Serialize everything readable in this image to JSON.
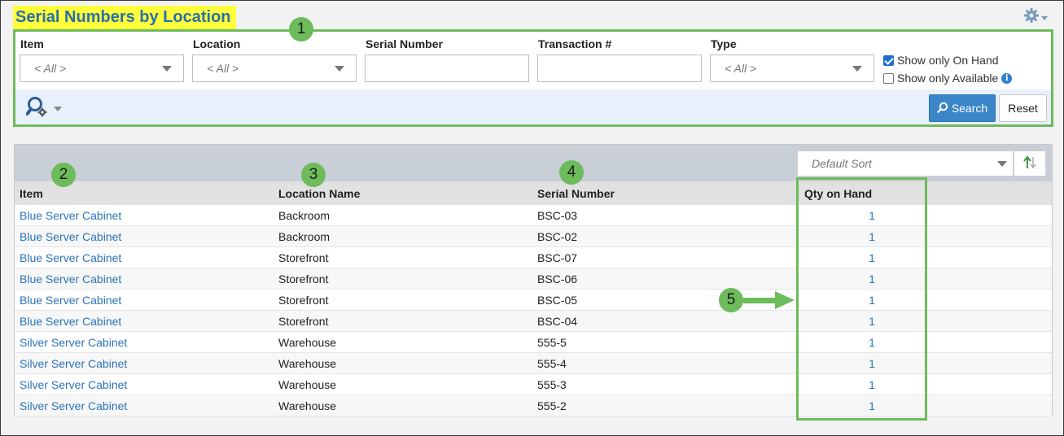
{
  "page": {
    "title": "Serial Numbers by Location"
  },
  "filters": {
    "item": {
      "label": "Item",
      "value": "< All >"
    },
    "location": {
      "label": "Location",
      "value": "< All >"
    },
    "serial_number": {
      "label": "Serial Number",
      "value": ""
    },
    "transaction": {
      "label": "Transaction #",
      "value": ""
    },
    "type": {
      "label": "Type",
      "value": "< All >"
    },
    "show_on_hand": {
      "label": "Show only On Hand",
      "checked": true
    },
    "show_available": {
      "label": "Show only Available",
      "checked": false
    },
    "search_label": "Search",
    "reset_label": "Reset"
  },
  "grid": {
    "sort": {
      "value": "Default Sort"
    },
    "columns": [
      "Item",
      "Location Name",
      "Serial Number",
      "Qty on Hand"
    ],
    "rows": [
      {
        "item": "Blue Server Cabinet",
        "location": "Backroom",
        "serial": "BSC-03",
        "qty": "1"
      },
      {
        "item": "Blue Server Cabinet",
        "location": "Backroom",
        "serial": "BSC-02",
        "qty": "1"
      },
      {
        "item": "Blue Server Cabinet",
        "location": "Storefront",
        "serial": "BSC-07",
        "qty": "1"
      },
      {
        "item": "Blue Server Cabinet",
        "location": "Storefront",
        "serial": "BSC-06",
        "qty": "1"
      },
      {
        "item": "Blue Server Cabinet",
        "location": "Storefront",
        "serial": "BSC-05",
        "qty": "1"
      },
      {
        "item": "Blue Server Cabinet",
        "location": "Storefront",
        "serial": "BSC-04",
        "qty": "1"
      },
      {
        "item": "Silver Server Cabinet",
        "location": "Warehouse",
        "serial": "555-5",
        "qty": "1"
      },
      {
        "item": "Silver Server Cabinet",
        "location": "Warehouse",
        "serial": "555-4",
        "qty": "1"
      },
      {
        "item": "Silver Server Cabinet",
        "location": "Warehouse",
        "serial": "555-3",
        "qty": "1"
      },
      {
        "item": "Silver Server Cabinet",
        "location": "Warehouse",
        "serial": "555-2",
        "qty": "1"
      }
    ]
  },
  "annotations": {
    "badge_1": "1",
    "badge_2": "2",
    "badge_3": "3",
    "badge_4": "4",
    "badge_5": "5"
  },
  "icons": {
    "settings": "gear-icon",
    "advanced_search": "search-settings-icon",
    "search": "magnifier-icon",
    "sort_toggle": "sort-direction-icon",
    "info": "info-icon"
  },
  "colors": {
    "title_highlight": "#ffff3c",
    "title_text": "#2a6fa8",
    "annotation_green": "#6dbb5a",
    "link_blue": "#2a73b9",
    "search_button": "#3a86c8"
  }
}
